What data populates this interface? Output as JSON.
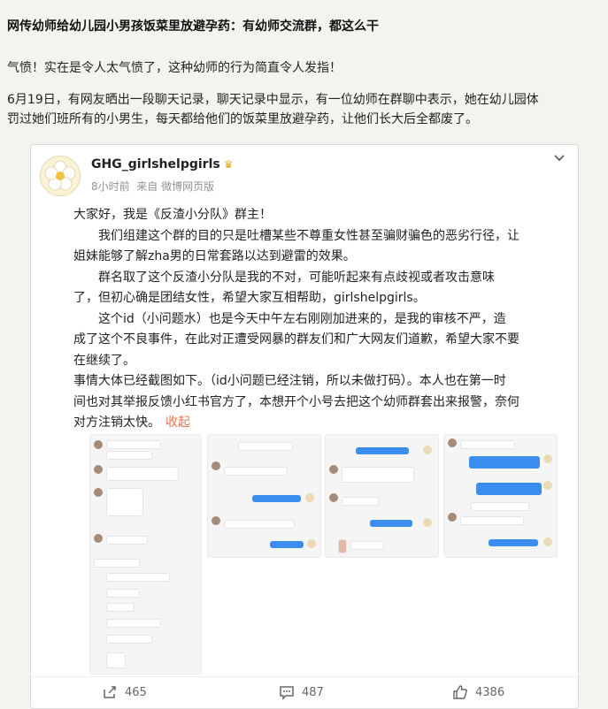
{
  "article": {
    "headline": "网传幼师给幼儿园小男孩饭菜里放避孕药：有幼师交流群，都这么干",
    "para1": "气愤！实在是令人太气愤了，这种幼师的行为简直令人发指！",
    "para2_line1": "6月19日，有网友晒出一段聊天记录，聊天记录中显示，有一位幼师在群聊中表示，她在幼儿园体",
    "para2_line2": "罚过她们班所有的小男生，每天都给他们的饭菜里放避孕药，让他们长大后全都废了。"
  },
  "post": {
    "username": "GHG_girlshelpgirls",
    "crown_icon": "crown-icon",
    "time": "8小时前",
    "source": "来自 微博网页版",
    "lines": [
      "大家好，我是《反渣小分队》群主！",
      "我们组建这个群的目的只是吐槽某些不尊重女性甚至骗财骗色的恶劣行径，让",
      "姐妹能够了解zha男的日常套路以达到避雷的效果。",
      "群名取了这个反渣小分队是我的不对，可能听起来有点歧视或者攻击意味",
      "了，但初心确是团结女性，希望大家互相帮助，girlshelpgirls。",
      "这个id（小问题水）也是今天中午左右刚刚加进来的，是我的审核不严，造",
      "成了这个不良事件，在此对正遭受网暴的群友们和广大网友们道歉，希望大家不要",
      "在继续了。",
      "事情大体已经截图如下。（id小问题已经注销，所以未做打码）。本人也在第一时",
      "间也对其举报反馈小红书官方了，本想开个小号去把这个幼师群套出来报警，奈何",
      "对方注销太快。"
    ],
    "fold_label": "收起",
    "repost_count": "465",
    "comment_count": "487",
    "like_count": "4386"
  }
}
